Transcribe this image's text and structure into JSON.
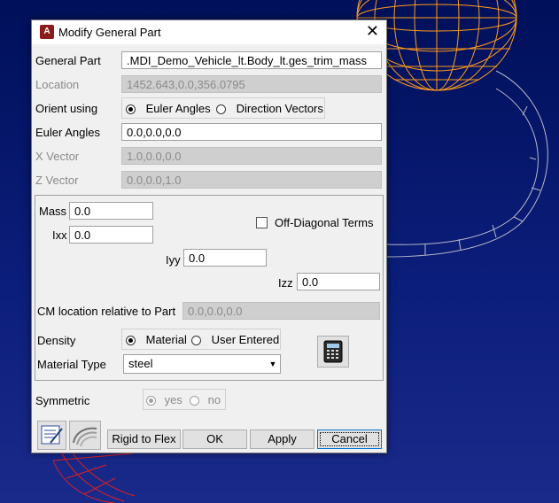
{
  "dialog": {
    "title": "Modify General Part",
    "app_icon_letter": "A",
    "close_glyph": "✕"
  },
  "general_part": {
    "label": "General Part",
    "value": ".MDI_Demo_Vehicle_lt.Body_lt.ges_trim_mass"
  },
  "location": {
    "label": "Location",
    "value": "1452.643,0.0,356.0795"
  },
  "orient": {
    "label": "Orient using",
    "options": [
      "Euler Angles",
      "Direction Vectors"
    ],
    "selected": "Euler Angles"
  },
  "euler_angles": {
    "label": "Euler Angles",
    "value": "0.0,0.0,0.0"
  },
  "x_vector": {
    "label": "X Vector",
    "value": "1.0,0.0,0.0"
  },
  "z_vector": {
    "label": "Z Vector",
    "value": "0.0,0.0,1.0"
  },
  "mass": {
    "label": "Mass",
    "value": "0.0"
  },
  "ixx": {
    "label": "Ixx",
    "value": "0.0"
  },
  "iyy": {
    "label": "Iyy",
    "value": "0.0"
  },
  "izz": {
    "label": "Izz",
    "value": "0.0"
  },
  "off_diagonal": {
    "label": "Off-Diagonal Terms",
    "checked": false
  },
  "cm_location": {
    "label": "CM location relative to Part",
    "value": "0.0,0.0,0.0"
  },
  "density": {
    "label": "Density",
    "options": [
      "Material",
      "User Entered"
    ],
    "selected": "Material"
  },
  "material_type": {
    "label": "Material Type",
    "value": "steel"
  },
  "symmetric": {
    "label": "Symmetric",
    "options": [
      "yes",
      "no"
    ],
    "selected": "yes"
  },
  "buttons": {
    "rigid_to_flex": "Rigid to Flex",
    "ok": "OK",
    "apply": "Apply",
    "cancel": "Cancel"
  },
  "icons": [
    "calculator-icon",
    "edit-table-icon",
    "flex-shape-icon"
  ],
  "colors": {
    "wireframe": "#ff9a1a",
    "background": "#0b1d7a",
    "red_wire": "#e02020"
  }
}
